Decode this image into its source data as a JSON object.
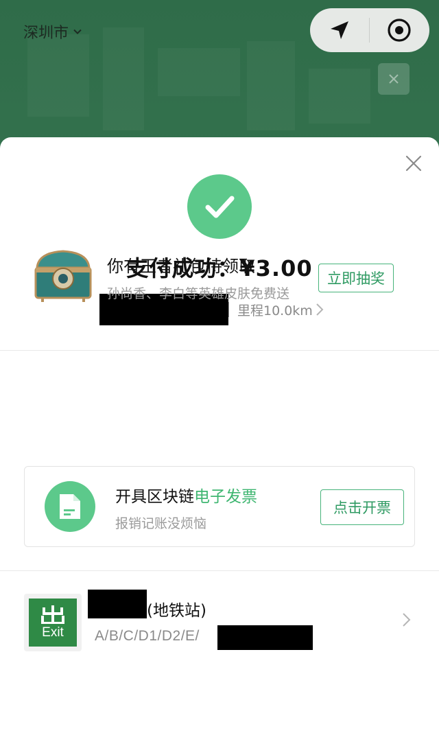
{
  "map": {
    "city_label": "深圳市",
    "icons": {
      "city_dropdown": "chevron-down-icon",
      "navigate": "navigation-arrow-icon",
      "locate": "target-icon",
      "overlay_close": "close-icon"
    }
  },
  "payment": {
    "status_icon": "check-icon",
    "title": "支付成功：¥3.00",
    "mileage": "里程10.0km",
    "close_icon": "close-icon"
  },
  "promo": {
    "title": "你有王者礼包待领取",
    "subtitle": "孙尚香、李白等英雄皮肤免费送",
    "button_label": "立即抽奖",
    "icon": "treasure-chest-icon"
  },
  "invoice": {
    "title_prefix": "开具区块链",
    "title_accent": "电子发票",
    "subtitle": "报销记账没烦恼",
    "button_label": "点击开票",
    "icon": "document-icon"
  },
  "station": {
    "name_suffix": "(地铁站)",
    "exits": "A/B/C/D1/D2/E/",
    "badge_char": "出",
    "badge_text": "Exit"
  },
  "colors": {
    "brand_green": "#5cc98b",
    "accent_text_green": "#3fb671",
    "map_green": "#2f6c49",
    "exit_green": "#2f8a46"
  }
}
